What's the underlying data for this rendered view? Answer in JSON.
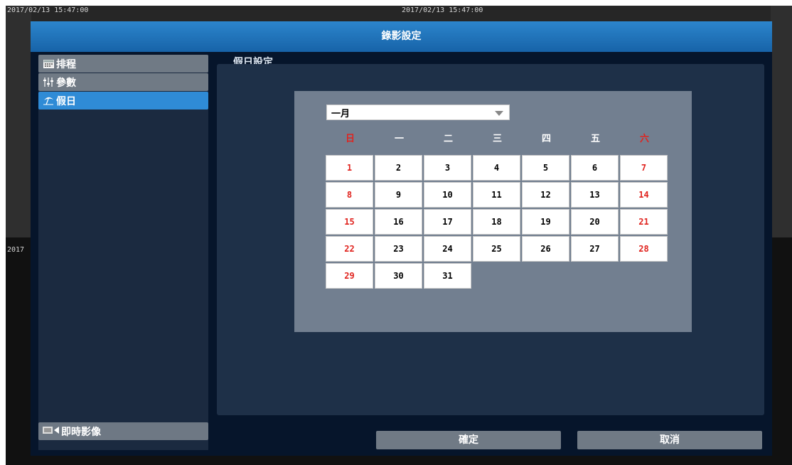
{
  "osd": {
    "time_left": "2017/02/13 15:47:00",
    "time_center": "2017/02/13 15:47:00",
    "time_mid_left": "2017"
  },
  "dialog": {
    "title": "錄影設定"
  },
  "sidebar": {
    "items": [
      {
        "label": "排程",
        "icon": "calendar-icon"
      },
      {
        "label": "參數",
        "icon": "sliders-icon"
      },
      {
        "label": "假日",
        "icon": "beach-umbrella-icon",
        "active": true
      }
    ],
    "live_view": {
      "label": "即時影像",
      "icon": "camera-icon"
    }
  },
  "content": {
    "section_title": "假日設定",
    "month_select": {
      "value": "一月"
    },
    "weekdays": [
      "日",
      "一",
      "二",
      "三",
      "四",
      "五",
      "六"
    ],
    "days": [
      "1",
      "2",
      "3",
      "4",
      "5",
      "6",
      "7",
      "8",
      "9",
      "10",
      "11",
      "12",
      "13",
      "14",
      "15",
      "16",
      "17",
      "18",
      "19",
      "20",
      "21",
      "22",
      "23",
      "24",
      "25",
      "26",
      "27",
      "28",
      "29",
      "30",
      "31"
    ],
    "holiday_color": "#e0231e"
  },
  "buttons": {
    "ok": "確定",
    "cancel": "取消"
  }
}
